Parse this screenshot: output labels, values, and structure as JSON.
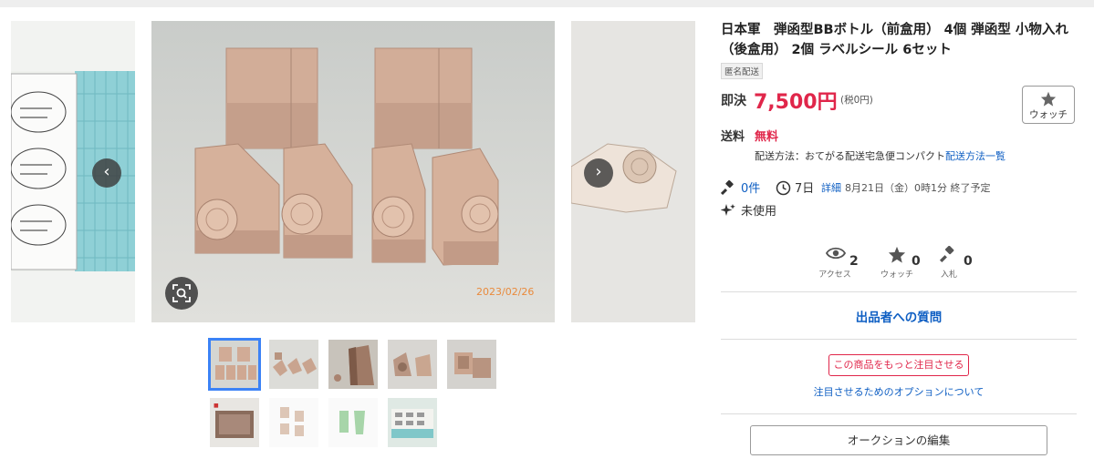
{
  "gallery": {
    "prev_label": "‹",
    "next_label": "›",
    "photo_date": "2023/02/26",
    "thumbnail_count": 9,
    "selected_thumbnail": 1
  },
  "item": {
    "title": "日本軍　弾函型BBボトル（前盒用） 4個 弾函型 小物入れ（後盒用） 2個 ラベルシール 6セット",
    "anonymous_badge": "匿名配送"
  },
  "price": {
    "label": "即決",
    "value": "7,500円",
    "tax": "(税0円)"
  },
  "watch_button": {
    "label": "ウォッチ"
  },
  "shipping": {
    "label": "送料",
    "fee": "無料",
    "method": "配送方法：おてがる配送宅急便コンパクト",
    "list_link": "配送方法一覧"
  },
  "auction": {
    "bids": "0件",
    "days_left": "7日",
    "detail_link": "詳細",
    "end_time": "8月21日（金）0時1分 終了予定"
  },
  "condition": "未使用",
  "stats": {
    "access_label": "アクセス",
    "access_value": "2",
    "watch_label": "ウォッチ",
    "watch_value": "0",
    "bid_label": "入札",
    "bid_value": "0"
  },
  "question_link": "出品者への質問",
  "promote": {
    "button": "この商品をもっと注目させる",
    "options_link": "注目させるためのオプションについて"
  },
  "edit_button": "オークションの編集",
  "colors": {
    "price_red": "#e0264a",
    "link_blue": "#0f5fc3",
    "thumb_selected": "#3b82f6"
  }
}
